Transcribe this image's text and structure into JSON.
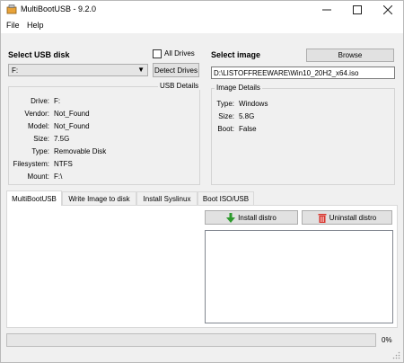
{
  "window": {
    "title": "MultiBootUSB - 9.2.0"
  },
  "menu": {
    "file": "File",
    "help": "Help"
  },
  "usb": {
    "section_label": "Select USB disk",
    "selected_drive": "F:",
    "all_drives_label": "All Drives",
    "detect_button": "Detect Drives",
    "details_title": "USB Details",
    "details": [
      {
        "key": "Drive:",
        "value": "F:"
      },
      {
        "key": "Vendor:",
        "value": "Not_Found"
      },
      {
        "key": "Model:",
        "value": "Not_Found"
      },
      {
        "key": "Size:",
        "value": "7.5G"
      },
      {
        "key": "Type:",
        "value": "Removable Disk"
      },
      {
        "key": "Filesystem:",
        "value": "NTFS"
      },
      {
        "key": "Mount:",
        "value": "F:\\"
      }
    ]
  },
  "image": {
    "section_label": "Select image",
    "browse_button": "Browse",
    "path": "D:\\LISTOFFREEWARE\\Win10_20H2_x64.iso",
    "details_title": "Image Details",
    "details": [
      {
        "key": "Type:",
        "value": "Windows"
      },
      {
        "key": "Size:",
        "value": "5.8G"
      },
      {
        "key": "Boot:",
        "value": "False"
      }
    ]
  },
  "tabs": [
    {
      "label": "MultiBootUSB"
    },
    {
      "label": "Write Image to disk"
    },
    {
      "label": "Install Syslinux"
    },
    {
      "label": "Boot ISO/USB"
    }
  ],
  "actions": {
    "install": "Install distro",
    "uninstall": "Uninstall distro"
  },
  "progress": {
    "value": 0,
    "label": "0%"
  },
  "colors": {
    "install_icon": "#2e9a2e",
    "uninstall_icon": "#d9332b"
  }
}
